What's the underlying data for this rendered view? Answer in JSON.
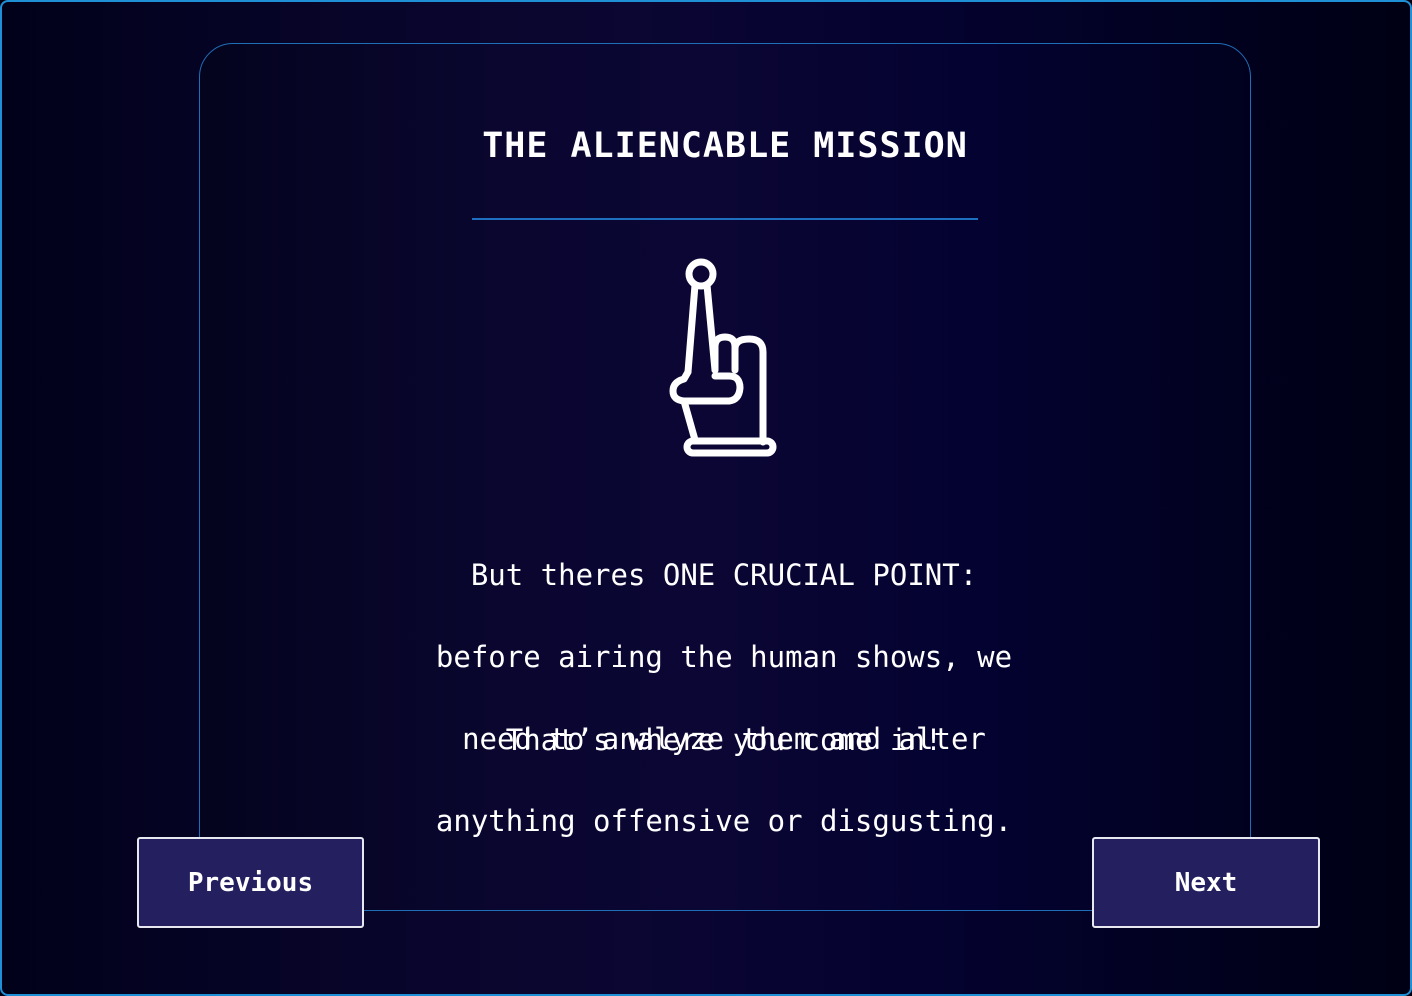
{
  "dialog": {
    "title": "THE ALIENCABLE MISSION",
    "icon": "raised-index-finger-hand-icon",
    "paragraph_lines": [
      "But theres ONE CRUCIAL POINT:",
      "before airing the human shows, we",
      "need to analyze them and alter",
      "anything offensive or disgusting."
    ],
    "closing_line": "That’s where you come in!"
  },
  "navigation": {
    "previous_label": "Previous",
    "next_label": "Next"
  },
  "colors": {
    "accent_border": "#1f8fd6",
    "button_fill": "#24205f",
    "text": "#ffffff"
  }
}
